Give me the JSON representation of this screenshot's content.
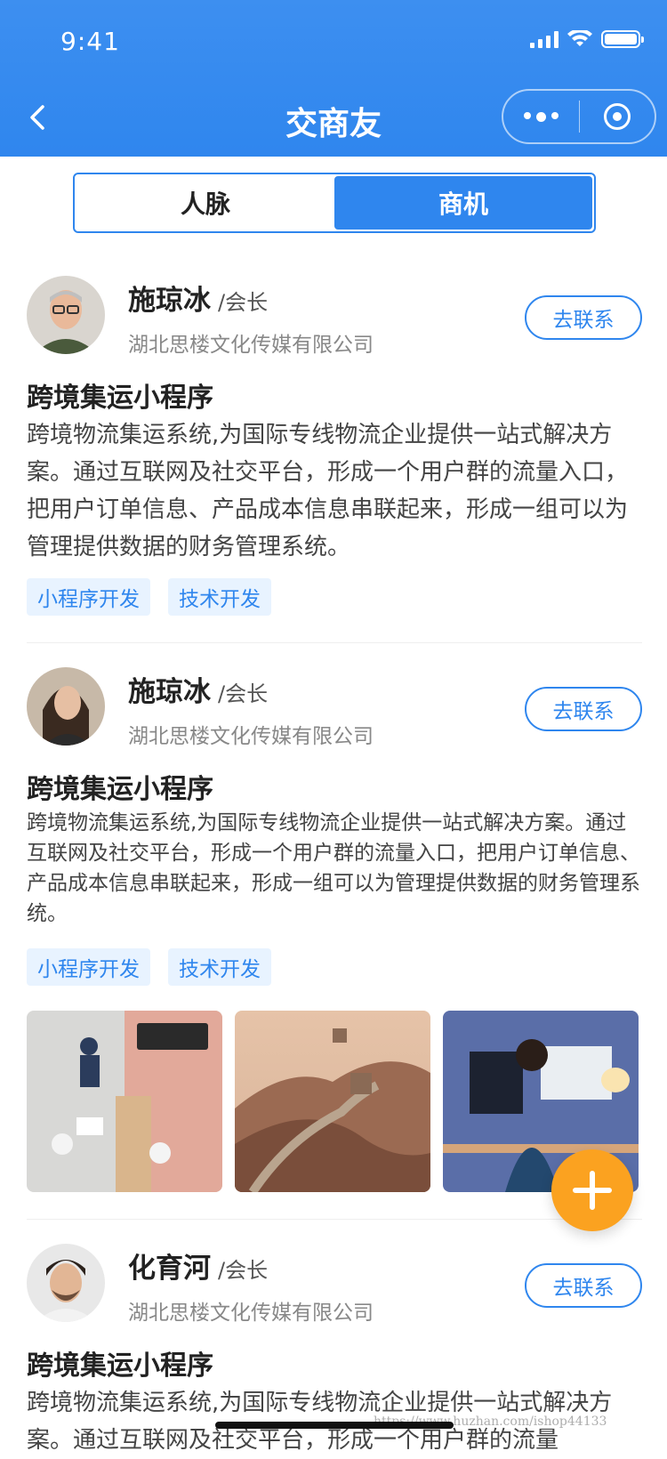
{
  "status_bar": {
    "time": "9:41"
  },
  "nav": {
    "title": "交商友"
  },
  "tabs": [
    {
      "label": "人脉",
      "active": false
    },
    {
      "label": "商机",
      "active": true
    }
  ],
  "colors": {
    "primary": "#2f86ee",
    "fab": "#fba220",
    "tag_bg": "#e8f3ff"
  },
  "posts": [
    {
      "name": "施琼冰",
      "role": "/会长",
      "company": "湖北思楼文化传媒有限公司",
      "contact_label": "去联系",
      "title": "跨境集运小程序",
      "description": "跨境物流集运系统,为国际专线物流企业提供一站式解决方案。通过互联网及社交平台，形成一个用户群的流量入口，把用户订单信息、产品成本信息串联起来，形成一组可以为管理提供数据的财务管理系统。",
      "tags": [
        "小程序开发",
        "技术开发"
      ]
    },
    {
      "name": "施琼冰",
      "role": "/会长",
      "company": "湖北思楼文化传媒有限公司",
      "contact_label": "去联系",
      "title": "跨境集运小程序",
      "description": "跨境物流集运系统,为国际专线物流企业提供一站式解决方案。通过互联网及社交平台，形成一个用户群的流量入口，把用户订单信息、产品成本信息串联起来，形成一组可以为管理提供数据的财务管理系统。",
      "tags": [
        "小程序开发",
        "技术开发"
      ],
      "photos": [
        "office-meeting-photo",
        "great-wall-photo",
        "programmer-desk-photo"
      ]
    },
    {
      "name": "化育河",
      "role": "/会长",
      "company": "湖北思楼文化传媒有限公司",
      "contact_label": "去联系",
      "title": "跨境集运小程序",
      "description": "跨境物流集运系统,为国际专线物流企业提供一站式解决方案。通过互联网及社交平台，形成一个用户群的流量",
      "tags": []
    }
  ],
  "watermark": "https://www.huzhan.com/ishop44133"
}
